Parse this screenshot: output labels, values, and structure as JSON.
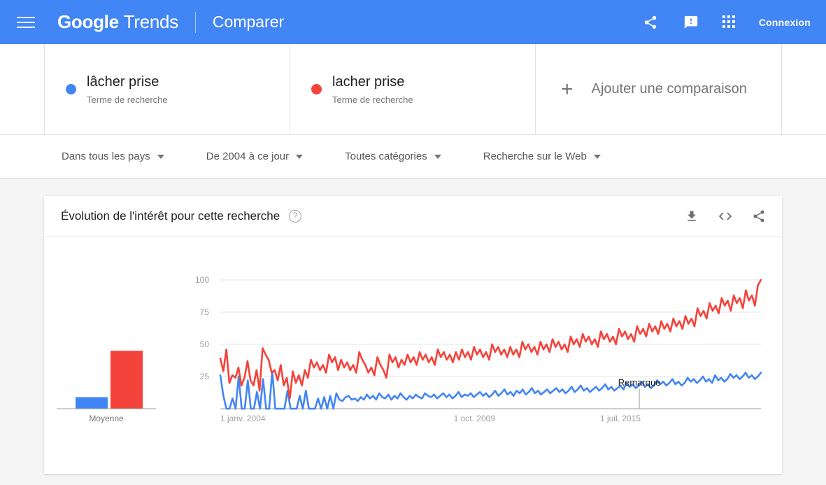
{
  "header": {
    "menu_icon": "hamburger-menu-icon",
    "brand_google": "Google",
    "brand_trends": "Trends",
    "subtitle": "Comparer",
    "share_icon": "share-icon",
    "feedback_icon": "feedback-icon",
    "apps_icon": "apps-grid-icon",
    "signin_label": "Connexion"
  },
  "compare": {
    "items": [
      {
        "term": "lâcher prise",
        "subtitle": "Terme de recherche",
        "color": "#4285f4"
      },
      {
        "term": "lacher prise",
        "subtitle": "Terme de recherche",
        "color": "#f4433a"
      }
    ],
    "add_label": "Ajouter une comparaison",
    "add_icon": "plus-icon"
  },
  "filters": [
    {
      "label": "Dans tous les pays",
      "name": "filter-country"
    },
    {
      "label": "De 2004 à ce jour",
      "name": "filter-date-range"
    },
    {
      "label": "Toutes catégories",
      "name": "filter-category"
    },
    {
      "label": "Recherche sur le Web",
      "name": "filter-search-type"
    }
  ],
  "chart_card": {
    "title": "Évolution de l'intérêt pour cette recherche",
    "help_icon": "help-circle-icon",
    "help_glyph": "?",
    "actions": [
      {
        "name": "download-icon",
        "label": "download"
      },
      {
        "name": "embed-code-icon",
        "label": "embed"
      },
      {
        "name": "share-icon",
        "label": "share"
      }
    ]
  },
  "chart_data": {
    "type": "line",
    "title": "Évolution de l'intérêt pour cette recherche",
    "xlabel": "",
    "ylabel": "",
    "ylim": [
      0,
      100
    ],
    "yticks": [
      25,
      50,
      75,
      100
    ],
    "grid": true,
    "legend_position": "top-cards",
    "xticks": [
      "1 janv. 2004",
      "1 oct. 2009",
      "1 juil. 2015"
    ],
    "xtick_positions": [
      0,
      0.47,
      0.74
    ],
    "annotation": "Remarque",
    "annotation_x": 0.775,
    "annotation_y": 18,
    "series": [
      {
        "name": "lâcher prise",
        "color": "#4285f4",
        "average": 9,
        "values": [
          26,
          10,
          0,
          0,
          8,
          0,
          25,
          0,
          0,
          22,
          0,
          0,
          13,
          0,
          23,
          0,
          0,
          29,
          0,
          0,
          0,
          0,
          14,
          0,
          0,
          0,
          10,
          0,
          14,
          0,
          0,
          0,
          8,
          0,
          9,
          0,
          10,
          0,
          12,
          7,
          6,
          9,
          10,
          7,
          8,
          6,
          9,
          7,
          11,
          8,
          10,
          7,
          12,
          9,
          8,
          11,
          7,
          10,
          8,
          12,
          9,
          7,
          10,
          8,
          11,
          9,
          8,
          12,
          10,
          9,
          11,
          8,
          10,
          12,
          9,
          11,
          8,
          10,
          13,
          9,
          11,
          10,
          12,
          9,
          11,
          13,
          10,
          12,
          9,
          11,
          14,
          10,
          12,
          15,
          11,
          13,
          10,
          14,
          12,
          15,
          11,
          13,
          16,
          12,
          14,
          11,
          13,
          15,
          12,
          14,
          16,
          13,
          15,
          12,
          14,
          17,
          13,
          15,
          18,
          14,
          16,
          13,
          15,
          17,
          14,
          16,
          19,
          15,
          17,
          14,
          16,
          18,
          15,
          20,
          17,
          19,
          16,
          18,
          21,
          17,
          19,
          16,
          18,
          22,
          19,
          21,
          18,
          20,
          23,
          19,
          21,
          18,
          20,
          24,
          21,
          23,
          20,
          22,
          25,
          21,
          23,
          20,
          26,
          22,
          24,
          21,
          23,
          27,
          24,
          26,
          23,
          25,
          28,
          24,
          26,
          23,
          25,
          28
        ]
      },
      {
        "name": "lacher prise",
        "color": "#f4433a",
        "average": 45,
        "values": [
          39,
          29,
          46,
          20,
          26,
          24,
          32,
          18,
          24,
          37,
          22,
          18,
          30,
          14,
          47,
          42,
          38,
          28,
          30,
          22,
          34,
          18,
          24,
          8,
          29,
          20,
          26,
          18,
          30,
          24,
          38,
          32,
          36,
          30,
          34,
          28,
          42,
          36,
          40,
          30,
          38,
          32,
          36,
          30,
          34,
          28,
          44,
          38,
          34,
          28,
          32,
          26,
          40,
          34,
          30,
          24,
          42,
          36,
          40,
          32,
          38,
          34,
          42,
          36,
          40,
          34,
          44,
          38,
          42,
          36,
          40,
          34,
          46,
          40,
          44,
          38,
          42,
          36,
          44,
          38,
          46,
          40,
          44,
          38,
          48,
          42,
          46,
          40,
          44,
          38,
          50,
          44,
          48,
          42,
          46,
          40,
          48,
          42,
          46,
          40,
          52,
          46,
          50,
          44,
          48,
          42,
          52,
          46,
          50,
          44,
          54,
          48,
          52,
          46,
          50,
          44,
          56,
          50,
          54,
          48,
          58,
          52,
          56,
          50,
          54,
          48,
          60,
          54,
          58,
          52,
          56,
          50,
          62,
          56,
          60,
          54,
          58,
          52,
          64,
          58,
          62,
          56,
          66,
          60,
          64,
          58,
          68,
          62,
          66,
          60,
          70,
          64,
          68,
          62,
          72,
          66,
          70,
          64,
          78,
          72,
          76,
          70,
          82,
          76,
          80,
          74,
          86,
          80,
          84,
          76,
          88,
          82,
          86,
          78,
          92,
          84,
          88,
          80,
          96,
          100
        ]
      }
    ]
  },
  "average_chart": {
    "type": "bar",
    "label": "Moyenne",
    "categories": [
      "lâcher prise",
      "lacher prise"
    ],
    "values": [
      9,
      45
    ],
    "colors": [
      "#4285f4",
      "#f4433a"
    ]
  }
}
